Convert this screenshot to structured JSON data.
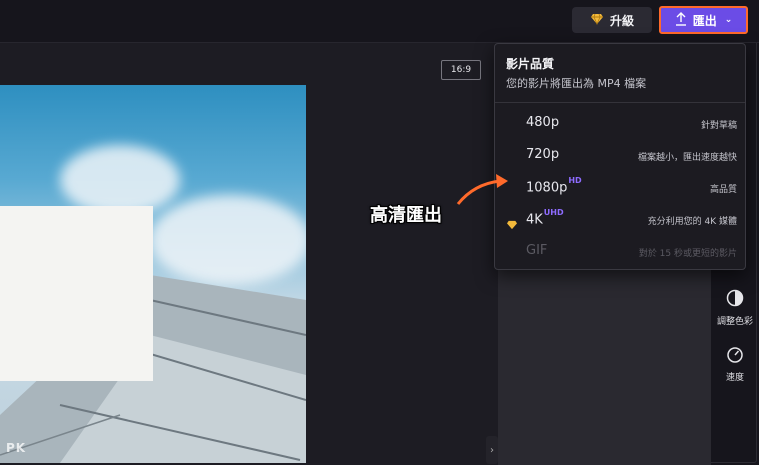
{
  "header": {
    "upgrade_label": "升級",
    "export_label": "匯出"
  },
  "canvas": {
    "ratio_label": "16:9",
    "watermark": "PK"
  },
  "export_menu": {
    "title": "影片品質",
    "subtitle": "您的影片將匯出為 MP4 檔案",
    "options": [
      {
        "res": "480p",
        "badge": "",
        "desc": "針對草稿",
        "enabled": true
      },
      {
        "res": "720p",
        "badge": "",
        "desc": "檔案越小，匯出速度越快",
        "enabled": true
      },
      {
        "res": "1080p",
        "badge": "HD",
        "desc": "高品質",
        "enabled": true
      },
      {
        "res": "4K",
        "badge": "UHD",
        "desc": "充分利用您的 4K 媒體",
        "enabled": true,
        "premium": true
      },
      {
        "res": "GIF",
        "badge": "",
        "desc": "對於 15 秒或更短的影片",
        "enabled": false
      }
    ]
  },
  "side_tools": [
    {
      "icon": "contrast-icon",
      "label": "調整色彩"
    },
    {
      "icon": "speedometer-icon",
      "label": "速度"
    }
  ],
  "annotation": {
    "text": "高清匯出",
    "color": "#ff6a2b"
  },
  "colors": {
    "accent": "#6b4ce6",
    "highlight": "#ff6a2b",
    "premium": "#f2b93b"
  }
}
